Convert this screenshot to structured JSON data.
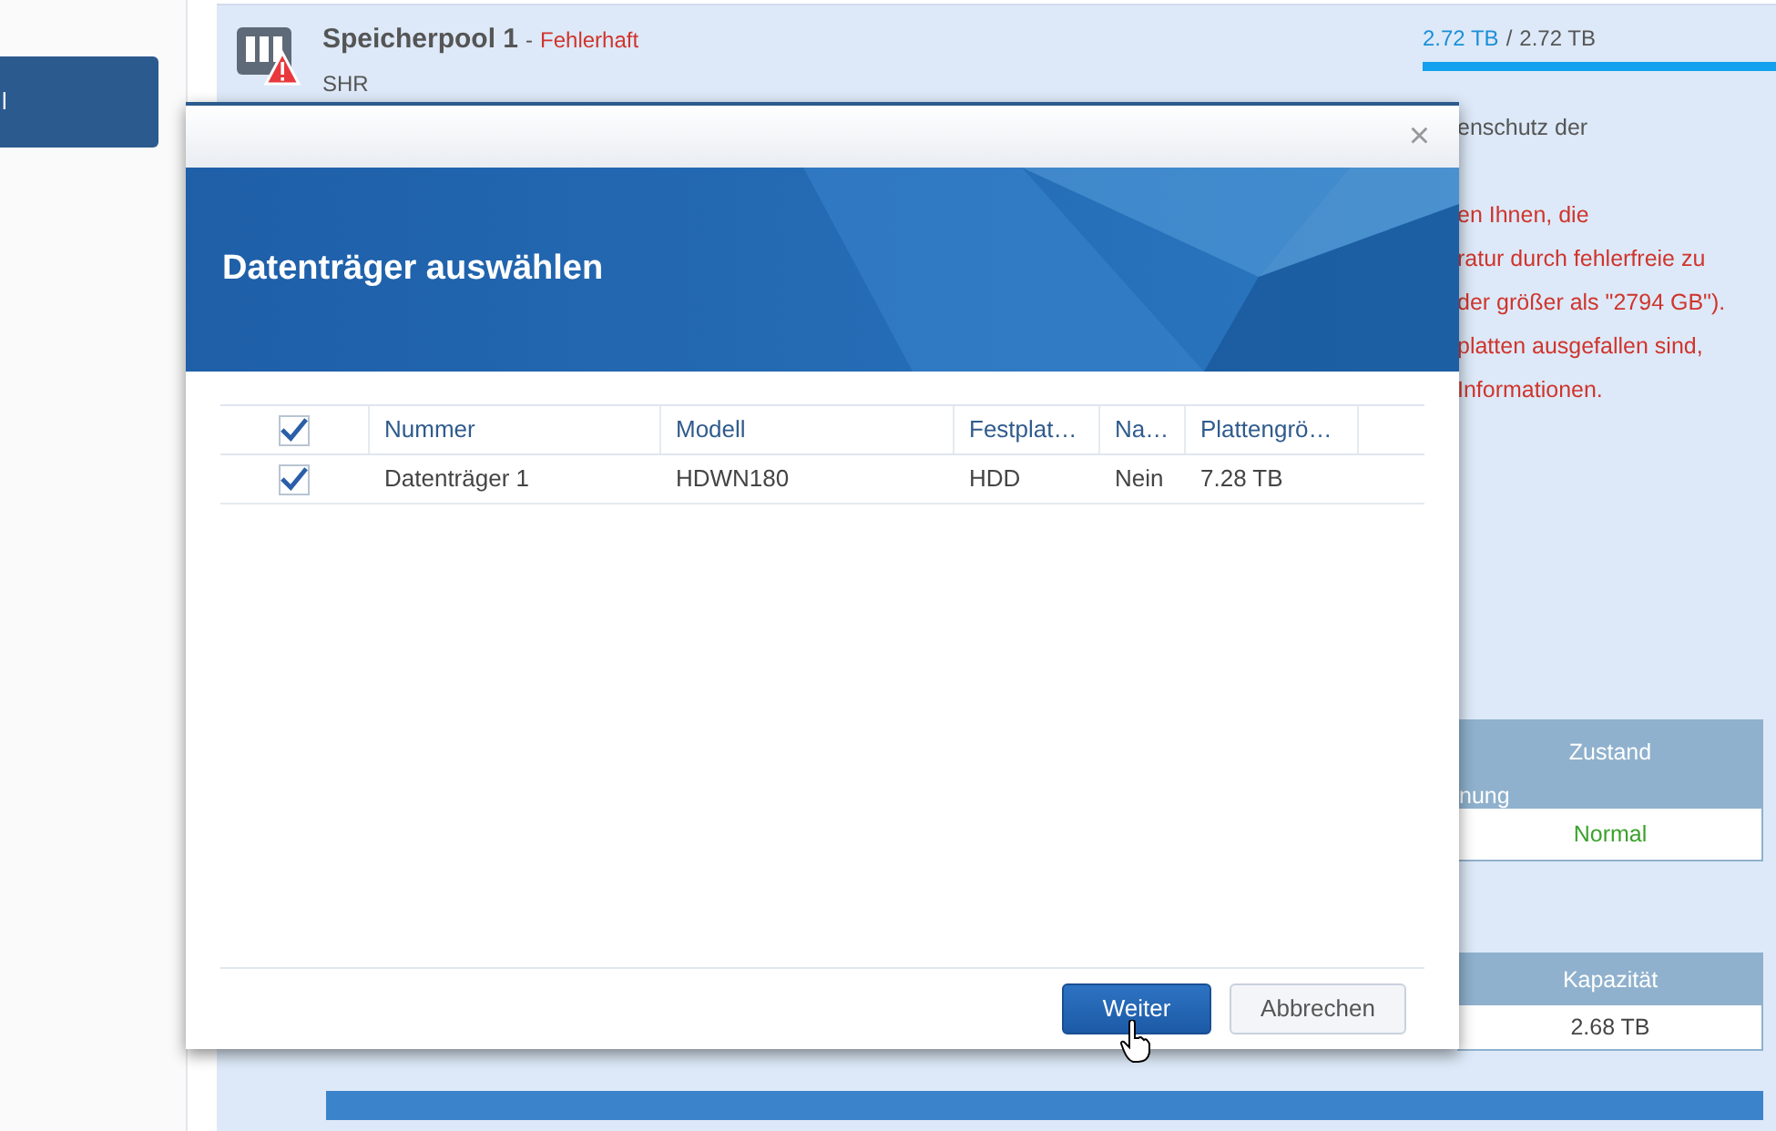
{
  "sidebar": {
    "items": [
      {
        "label": "l",
        "selected": true
      }
    ]
  },
  "pool": {
    "title": "Speicherpool 1",
    "separator": "-",
    "status": "Fehlerhaft",
    "type": "SHR",
    "used": "2.72 TB",
    "divider": "/",
    "total": "2.72 TB",
    "level": 1
  },
  "info": {
    "note": "enschutz der",
    "warnings": [
      "en Ihnen, die",
      "ratur durch fehlerfreie zu",
      "der größer als \"2794 GB\").",
      "platten ausgefallen sind,",
      "Informationen."
    ]
  },
  "status_table": {
    "header": "Zustand",
    "header_line_2": "nung",
    "cell": "Normal"
  },
  "capacity_table": {
    "header": "Kapazität",
    "cell": "2.68 TB"
  },
  "dialog": {
    "close": "×",
    "title": "Datenträger auswählen",
    "select_all_checked": true,
    "columns": [
      "Nummer",
      "Modell",
      "Festplat…",
      "Na…",
      "Plattengrö…"
    ],
    "rows": [
      {
        "checked": true,
        "cells": [
          "Datenträger 1",
          "HDWN180",
          "HDD",
          "Nein",
          "7.28 TB"
        ]
      }
    ],
    "buttons": [
      {
        "label": "Weiter",
        "kind": "primary"
      },
      {
        "label": "Abbrechen",
        "kind": "secondary"
      }
    ]
  }
}
